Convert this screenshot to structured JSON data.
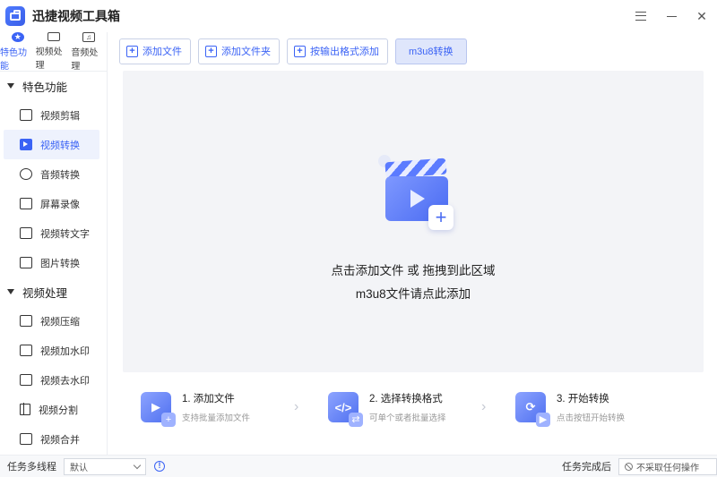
{
  "app": {
    "title": "迅捷视频工具箱"
  },
  "categories": [
    {
      "label": "特色功能",
      "icon": "star-icon",
      "active": true
    },
    {
      "label": "视频处理",
      "icon": "film-icon"
    },
    {
      "label": "音频处理",
      "icon": "music-icon"
    }
  ],
  "sidebar": {
    "section_featured": "特色功能",
    "featured_items": [
      {
        "label": "视频剪辑",
        "icon": "video-edit-icon"
      },
      {
        "label": "视频转换",
        "icon": "video-convert-icon",
        "active": true
      },
      {
        "label": "音频转换",
        "icon": "audio-convert-icon"
      },
      {
        "label": "屏幕录像",
        "icon": "screen-record-icon"
      },
      {
        "label": "视频转文字",
        "icon": "video-to-text-icon"
      },
      {
        "label": "图片转换",
        "icon": "image-convert-icon"
      }
    ],
    "section_video": "视频处理",
    "video_items": [
      {
        "label": "视频压缩",
        "icon": "compress-icon"
      },
      {
        "label": "视频加水印",
        "icon": "add-watermark-icon"
      },
      {
        "label": "视频去水印",
        "icon": "remove-watermark-icon"
      },
      {
        "label": "视频分割",
        "icon": "split-icon"
      },
      {
        "label": "视频合并",
        "icon": "merge-icon"
      }
    ]
  },
  "toolbar": {
    "add_file": "添加文件",
    "add_folder": "添加文件夹",
    "add_by_format": "按输出格式添加",
    "m3u8": "m3u8转换"
  },
  "dropzone": {
    "main_text": "点击添加文件 或 拖拽到此区域",
    "sub_text": "m3u8文件请点此添加"
  },
  "steps": [
    {
      "title": "1. 添加文件",
      "desc": "支持批量添加文件"
    },
    {
      "title": "2. 选择转换格式",
      "desc": "可单个或者批量选择"
    },
    {
      "title": "3. 开始转换",
      "desc": "点击按钮开始转换"
    }
  ],
  "statusbar": {
    "threads_label": "任务多线程",
    "threads_value": "默认",
    "after_label": "任务完成后",
    "after_value": "不采取任何操作"
  },
  "colors": {
    "accent": "#3b63f5",
    "dropzone_bg": "#f3f4f7"
  }
}
